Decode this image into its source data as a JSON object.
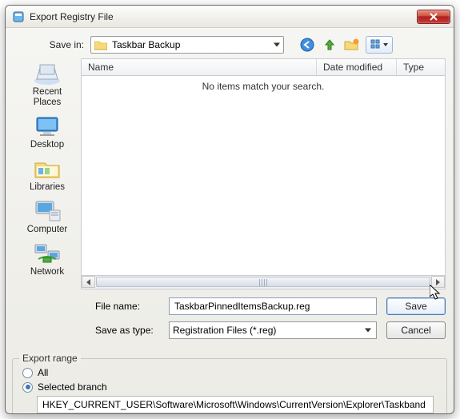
{
  "window": {
    "title": "Export Registry File"
  },
  "savein": {
    "label": "Save in:",
    "folder": "Taskbar Backup"
  },
  "toolbar": {
    "back": "back-icon",
    "up": "up-icon",
    "newfolder": "new-folder-icon",
    "views": "views-icon"
  },
  "places": {
    "items": [
      {
        "label": "Recent Places"
      },
      {
        "label": "Desktop"
      },
      {
        "label": "Libraries"
      },
      {
        "label": "Computer"
      },
      {
        "label": "Network"
      }
    ]
  },
  "columns": {
    "name": "Name",
    "date": "Date modified",
    "type": "Type"
  },
  "list": {
    "empty_message": "No items match your search."
  },
  "form": {
    "filename_label": "File name:",
    "filename_value": "TaskbarPinnedItemsBackup.reg",
    "type_label": "Save as type:",
    "type_value": "Registration Files (*.reg)",
    "save": "Save",
    "cancel": "Cancel"
  },
  "export_range": {
    "legend": "Export range",
    "all_label": "All",
    "selected_label": "Selected branch",
    "selected": true,
    "branch_value": "HKEY_CURRENT_USER\\Software\\Microsoft\\Windows\\CurrentVersion\\Explorer\\Taskband"
  }
}
